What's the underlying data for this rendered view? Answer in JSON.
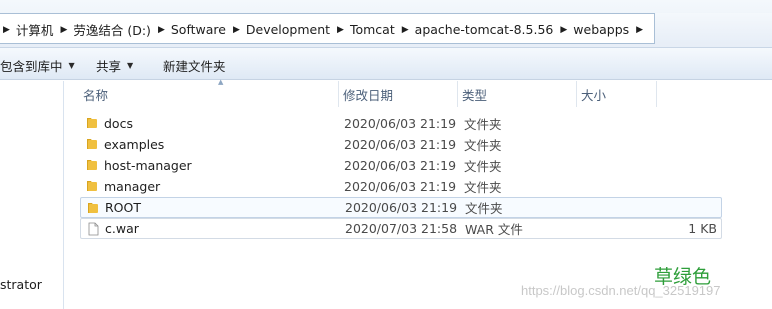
{
  "address_bar": {
    "crumbs": [
      "计算机",
      "劳逸结合 (D:)",
      "Software",
      "Development",
      "Tomcat",
      "apache-tomcat-8.5.56",
      "webapps"
    ]
  },
  "toolbar": {
    "include_in_library": "包含到库中",
    "share": "共享",
    "new_folder": "新建文件夹"
  },
  "nav": {
    "item_label": "strator"
  },
  "columns": {
    "name": "名称",
    "date": "修改日期",
    "type": "类型",
    "size": "大小"
  },
  "files": [
    {
      "name": "docs",
      "date": "2020/06/03 21:19",
      "type": "文件夹",
      "size": "",
      "icon": "folder-icon"
    },
    {
      "name": "examples",
      "date": "2020/06/03 21:19",
      "type": "文件夹",
      "size": "",
      "icon": "folder-icon"
    },
    {
      "name": "host-manager",
      "date": "2020/06/03 21:19",
      "type": "文件夹",
      "size": "",
      "icon": "folder-icon"
    },
    {
      "name": "manager",
      "date": "2020/06/03 21:19",
      "type": "文件夹",
      "size": "",
      "icon": "folder-icon"
    },
    {
      "name": "ROOT",
      "date": "2020/06/03 21:19",
      "type": "文件夹",
      "size": "",
      "icon": "folder-icon"
    },
    {
      "name": "c.war",
      "date": "2020/07/03 21:58",
      "type": "WAR 文件",
      "size": "1 KB",
      "icon": "file-icon"
    }
  ],
  "annotation": "草绿色",
  "watermark": "https://blog.csdn.net/qq_32519197",
  "colors": {
    "folder": "#f0c040",
    "annotation": "#2e9e3a",
    "selection_border": "#c3d3e6"
  }
}
